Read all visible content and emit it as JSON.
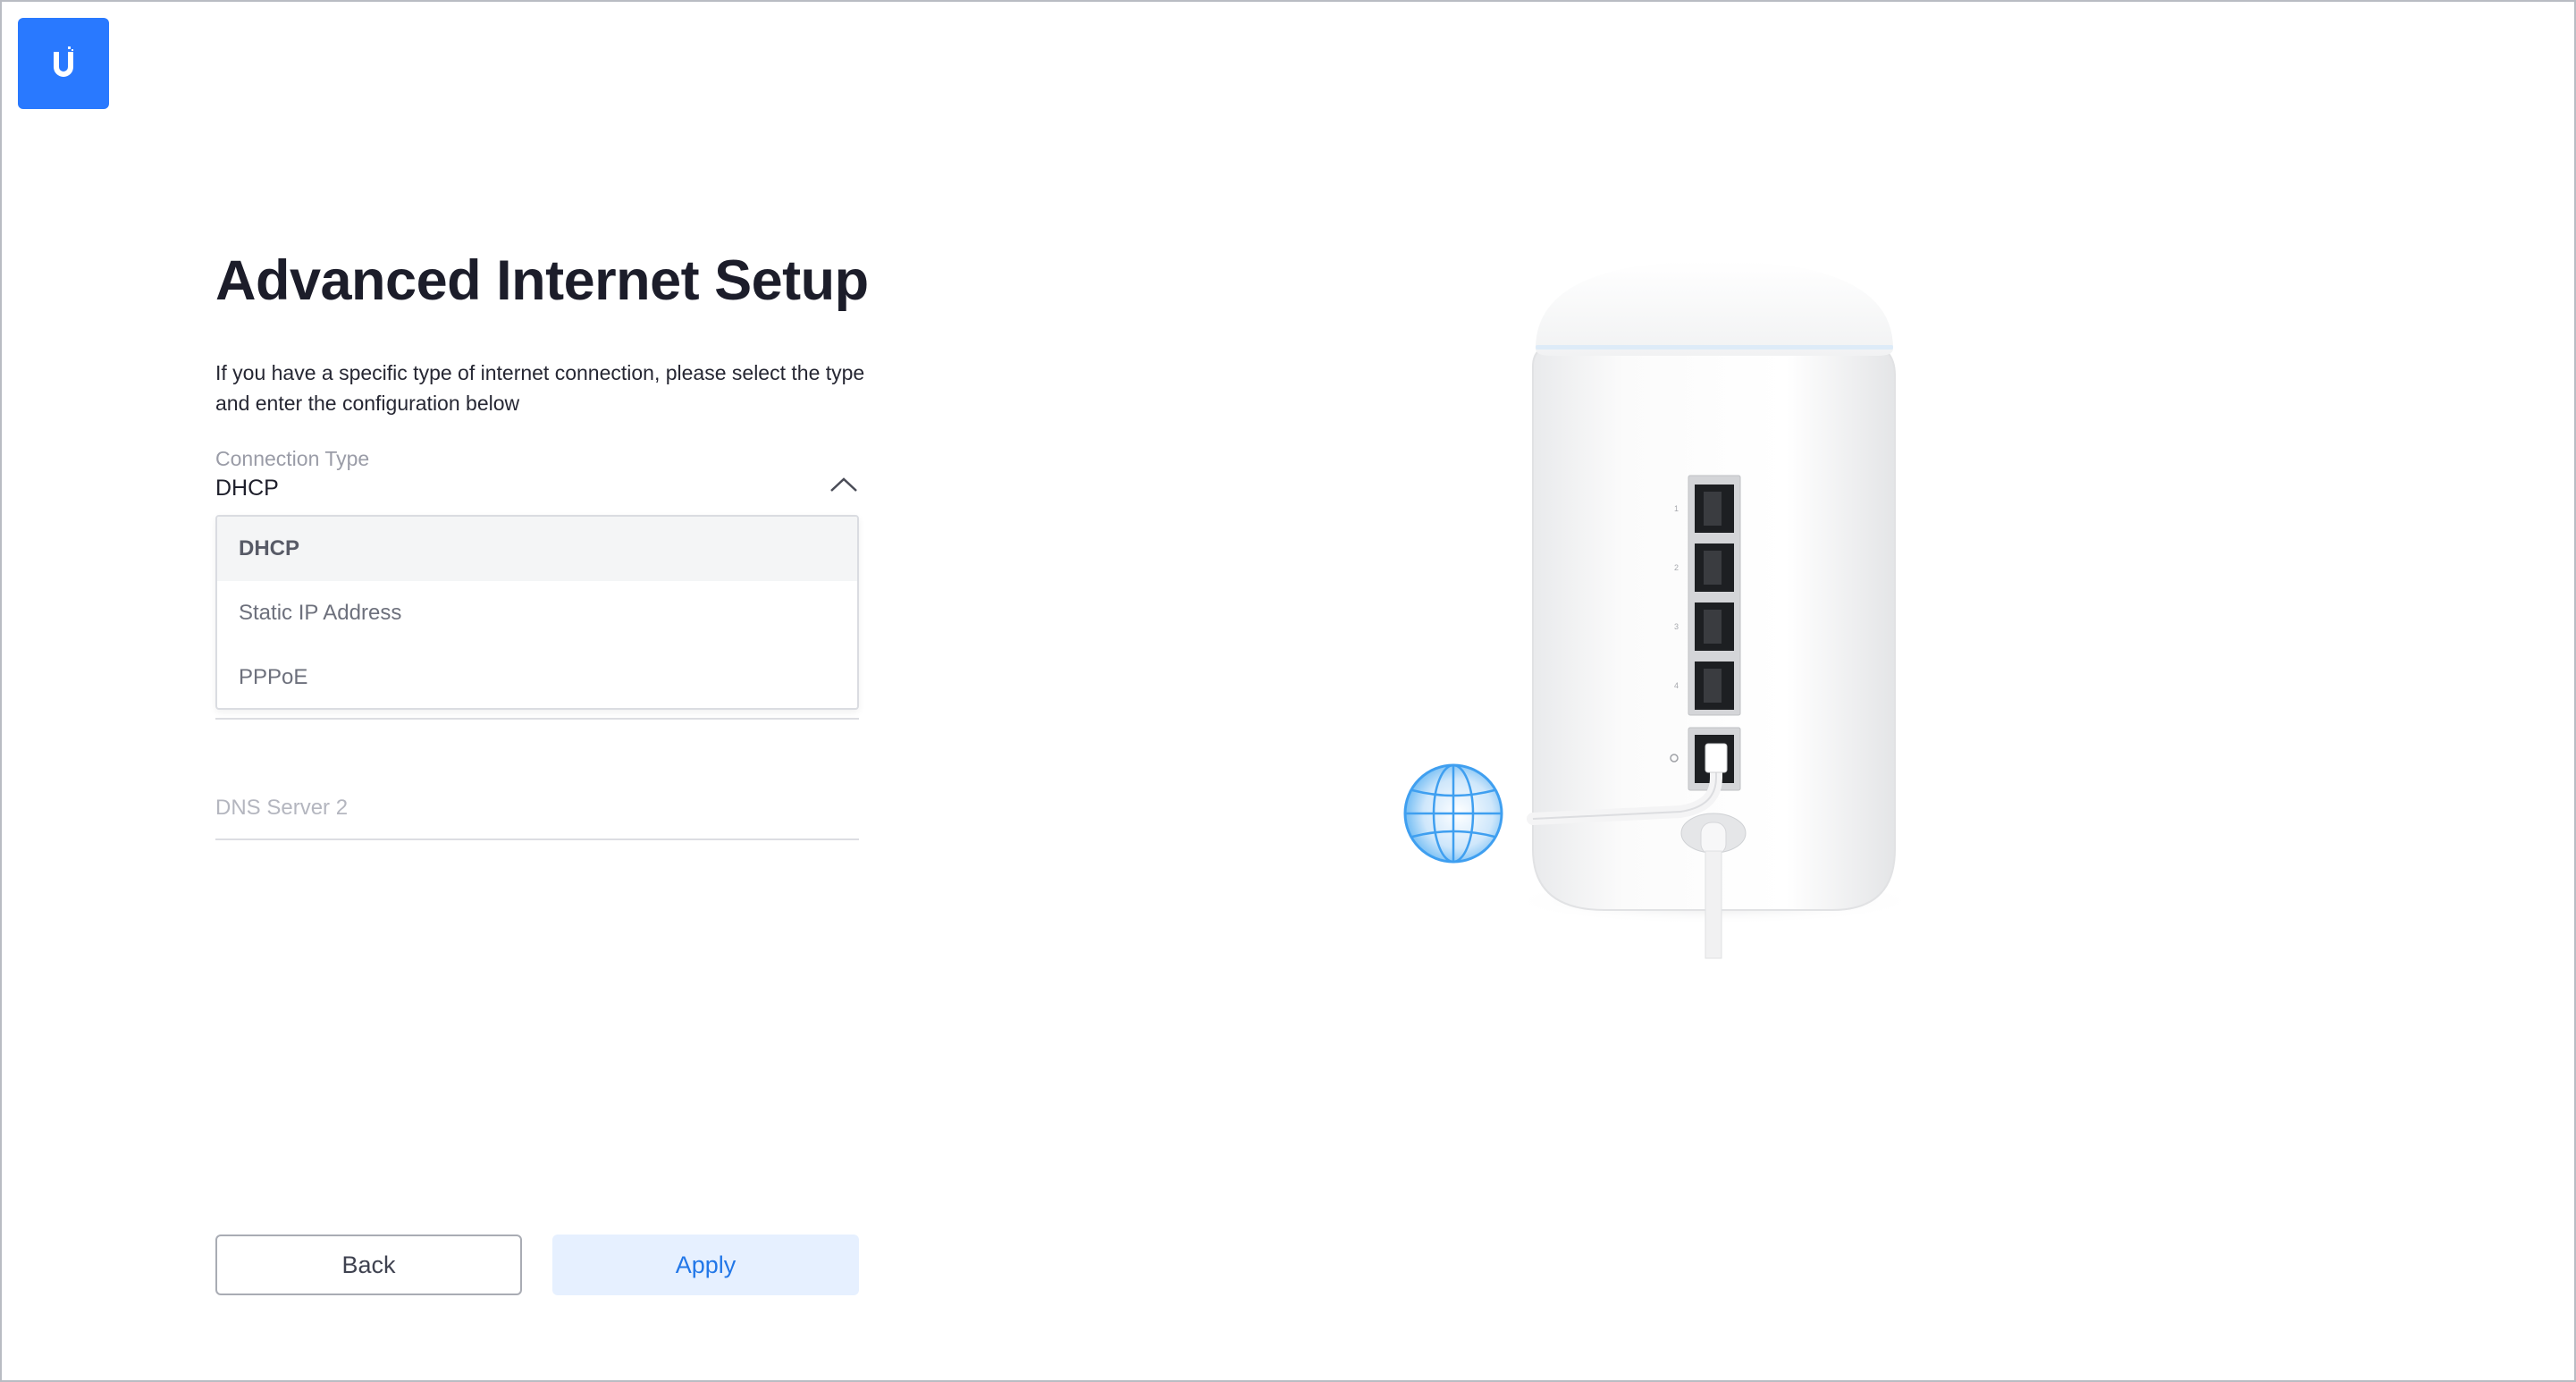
{
  "header": {
    "logo_icon": "ubiquiti-u-logo",
    "accent_color": "#2979ff"
  },
  "page": {
    "title": "Advanced Internet Setup",
    "description": "If you have a specific type of internet connection, please select the type and enter the configuration below"
  },
  "connection_type": {
    "label": "Connection Type",
    "value": "DHCP",
    "expanded": true,
    "options": [
      {
        "label": "DHCP",
        "selected": true
      },
      {
        "label": "Static IP Address",
        "selected": false
      },
      {
        "label": "PPPoE",
        "selected": false
      }
    ]
  },
  "dns_server_2": {
    "placeholder": "DNS Server 2",
    "value": ""
  },
  "buttons": {
    "back": "Back",
    "apply": "Apply"
  },
  "illustration": {
    "device_icon": "router-device-icon",
    "globe_icon": "globe-icon",
    "port_numbers": [
      "1",
      "2",
      "3",
      "4"
    ]
  }
}
